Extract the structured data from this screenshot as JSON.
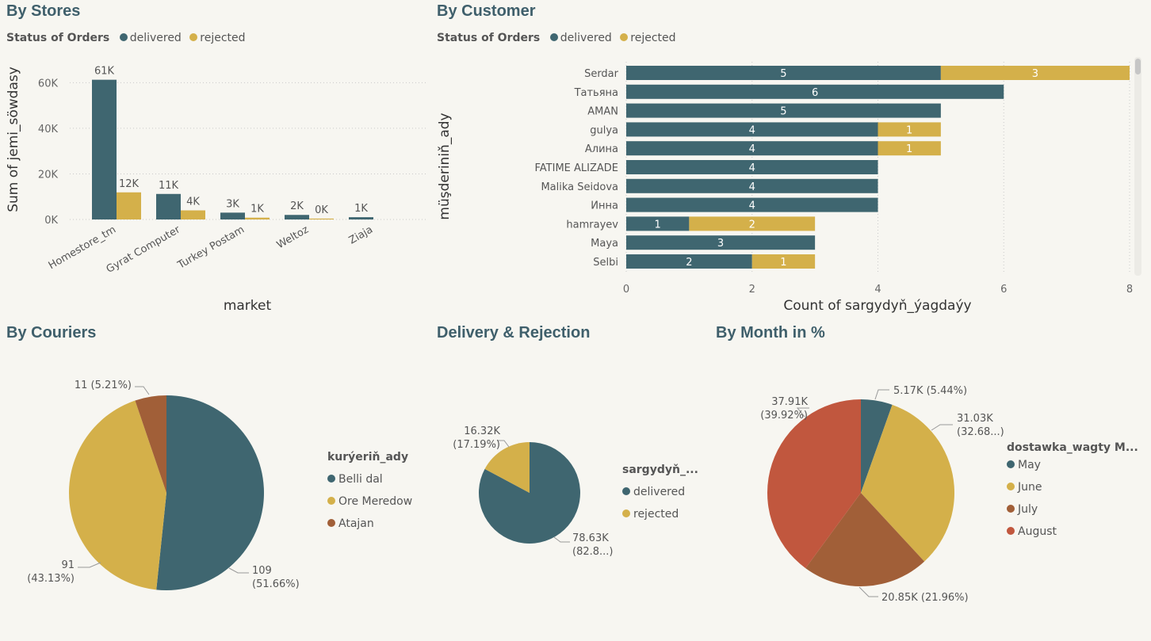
{
  "colors": {
    "delivered": "#3f6670",
    "rejected": "#d4b04a",
    "c3": "#a15f38",
    "c4": "#c1573e",
    "title": "#3f5f6b",
    "bg": "#f7f6f1"
  },
  "stores": {
    "title": "By Stores",
    "legend_title": "Status of Orders",
    "legend": [
      "delivered",
      "rejected"
    ],
    "chart_data": {
      "type": "bar",
      "categories": [
        "Homestore_tm",
        "Gyrat Computer",
        "Turkey Postam",
        "Weltoz",
        "Ziaja"
      ],
      "series": [
        {
          "name": "delivered",
          "values": [
            61300,
            11200,
            3000,
            2000,
            1000
          ],
          "labels": [
            "61K",
            "11K",
            "3K",
            "2K",
            "1K"
          ]
        },
        {
          "name": "rejected",
          "values": [
            11900,
            4000,
            800,
            400,
            0
          ],
          "labels": [
            "12K",
            "4K",
            "1K",
            "0K",
            ""
          ]
        }
      ],
      "xlabel": "market",
      "ylabel": "Sum of jemi_söwdasy",
      "ylim": [
        0,
        65000
      ],
      "yticks": [
        0,
        20000,
        40000,
        60000
      ],
      "ytick_labels": [
        "0K",
        "20K",
        "40K",
        "60K"
      ],
      "grid": true
    }
  },
  "customer": {
    "title": "By Customer",
    "legend_title": "Status of Orders",
    "legend": [
      "delivered",
      "rejected"
    ],
    "chart_data": {
      "type": "bar",
      "orientation": "horizontal",
      "categories": [
        "Serdar",
        "Татьяна",
        "AMAN",
        "gulya",
        "Алина",
        "FATIME ALIZADE",
        "Malika Seidova",
        "Инна",
        "hamrayev",
        "Maya",
        "Selbi"
      ],
      "series": [
        {
          "name": "delivered",
          "values": [
            5,
            6,
            5,
            4,
            4,
            4,
            4,
            4,
            1,
            3,
            2
          ]
        },
        {
          "name": "rejected",
          "values": [
            3,
            0,
            0,
            1,
            1,
            0,
            0,
            0,
            2,
            0,
            1
          ]
        }
      ],
      "xlabel": "Count of sargydyň_ýagdaýy",
      "ylabel": "müşderiniň_ady",
      "xlim": [
        0,
        8
      ],
      "xticks": [
        0,
        2,
        4,
        6,
        8
      ],
      "grid": true
    }
  },
  "couriers": {
    "title": "By Couriers",
    "legend_title": "kurýeriň_ady",
    "legend": [
      "Belli dal",
      "Ore Meredow",
      "Atajan"
    ],
    "chart_data": {
      "type": "pie",
      "labels": [
        "Belli dal",
        "Ore Meredow",
        "Atajan"
      ],
      "values": [
        109,
        91,
        11
      ],
      "percent": [
        "51.66%",
        "43.13%",
        "5.21%"
      ],
      "data_labels": [
        [
          "109",
          "(51.66%)"
        ],
        [
          "91",
          "(43.13%)"
        ],
        [
          "11 (5.21%)"
        ]
      ]
    }
  },
  "delivery": {
    "title": "Delivery & Rejection",
    "legend_title": "sargydyň_...",
    "legend": [
      "delivered",
      "rejected"
    ],
    "chart_data": {
      "type": "pie",
      "labels": [
        "delivered",
        "rejected"
      ],
      "values": [
        78.63,
        16.32
      ],
      "data_labels": [
        [
          "78.63K",
          "(82.8...)"
        ],
        [
          "16.32K",
          "(17.19%)"
        ]
      ]
    }
  },
  "month": {
    "title": "By Month in %",
    "legend_title": "dostawka_wagty M...",
    "legend": [
      "May",
      "June",
      "July",
      "August"
    ],
    "chart_data": {
      "type": "pie",
      "labels": [
        "May",
        "June",
        "July",
        "August"
      ],
      "values": [
        5.17,
        31.03,
        20.85,
        37.91
      ],
      "percent": [
        "5.44%",
        "32.68%",
        "21.96%",
        "39.92%"
      ],
      "data_labels": [
        [
          "5.17K (5.44%)"
        ],
        [
          "31.03K",
          "(32.68...)"
        ],
        [
          "20.85K (21.96%)"
        ],
        [
          "37.91K",
          "(39.92%)"
        ]
      ]
    }
  }
}
